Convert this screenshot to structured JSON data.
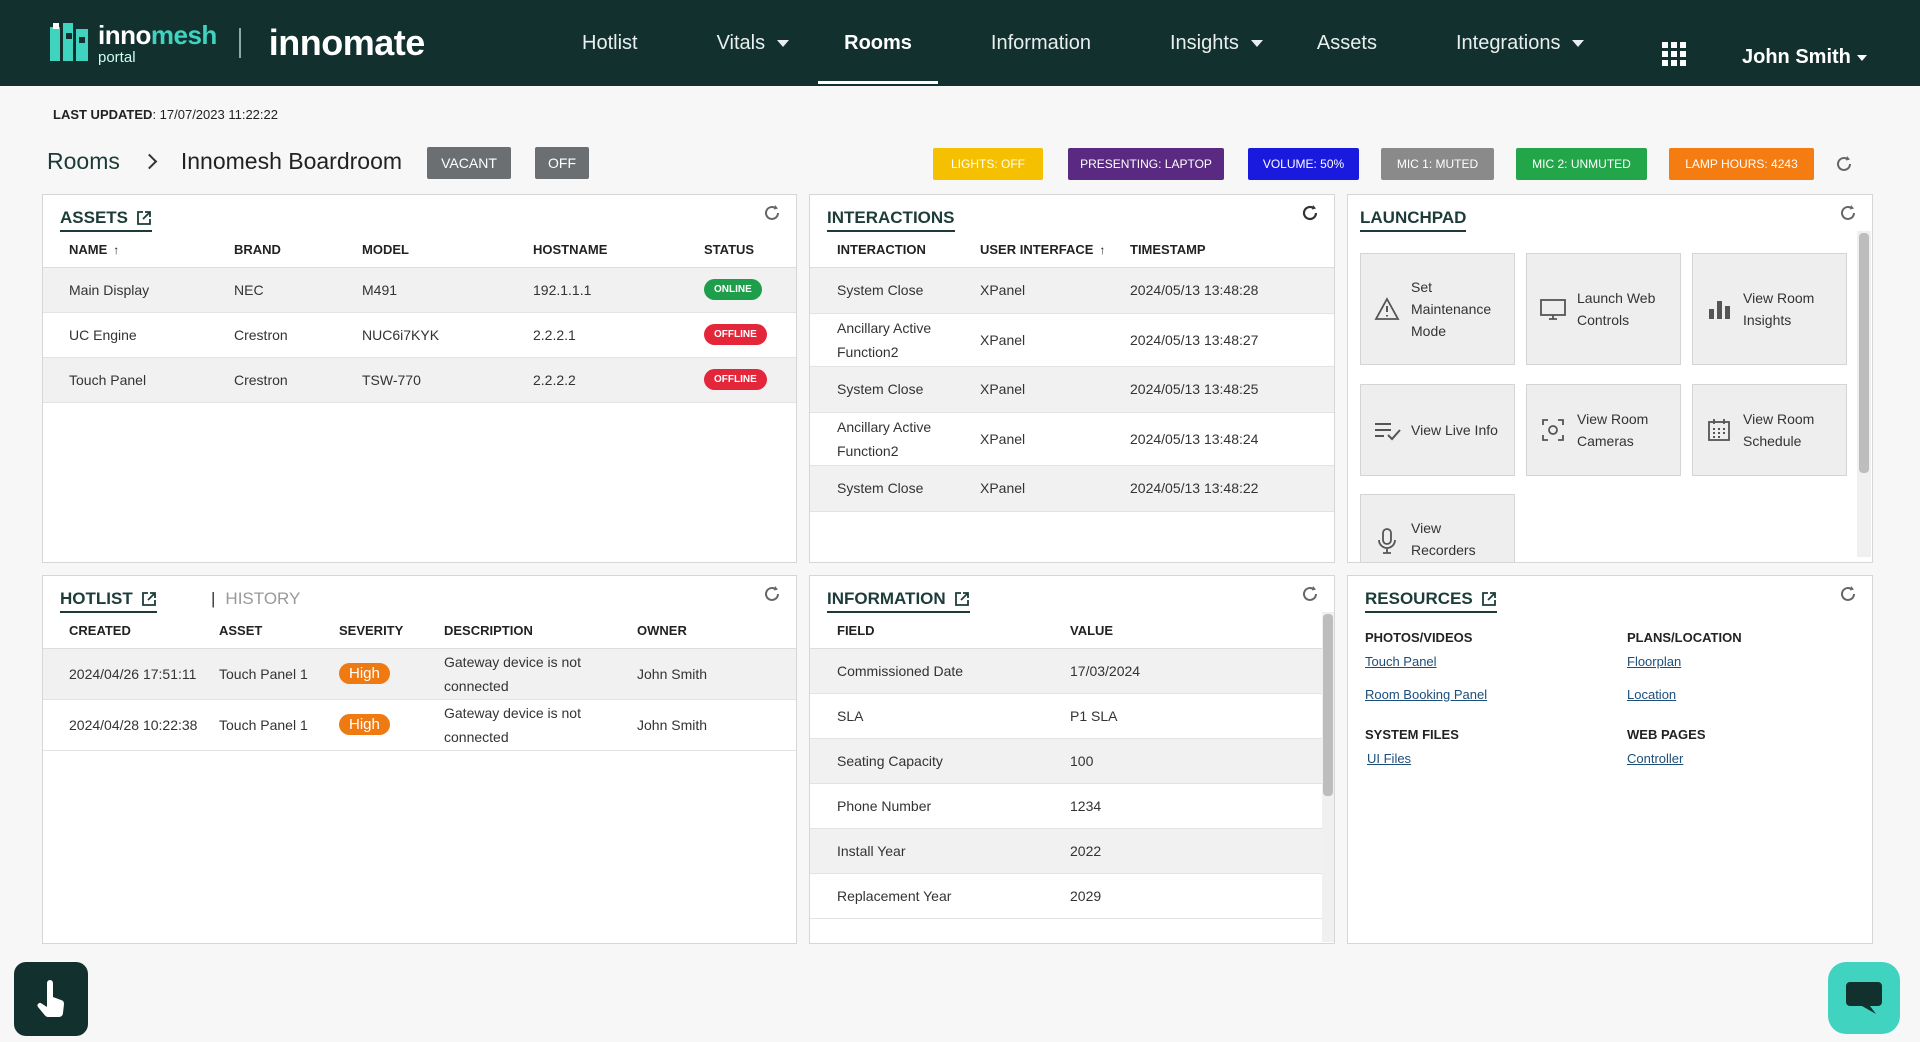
{
  "brand": {
    "innomesh_a": "inno",
    "innomesh_b": "mesh",
    "portal": "portal",
    "innomate": "innomate"
  },
  "nav": [
    {
      "label": "Hotlist",
      "dropdown": false,
      "active": false
    },
    {
      "label": "Vitals",
      "dropdown": true,
      "active": false
    },
    {
      "label": "Rooms",
      "dropdown": false,
      "active": true
    },
    {
      "label": "Information",
      "dropdown": false,
      "active": false
    },
    {
      "label": "Insights",
      "dropdown": true,
      "active": false
    },
    {
      "label": "Assets",
      "dropdown": false,
      "active": false
    },
    {
      "label": "Integrations",
      "dropdown": true,
      "active": false
    }
  ],
  "user": {
    "name": "John Smith"
  },
  "last_updated": {
    "label": "LAST UPDATED",
    "value": ": 17/07/2023 11:22:22"
  },
  "breadcrumb": {
    "root": "Rooms",
    "current": "Innomesh Boardroom"
  },
  "room_state": {
    "occupancy": "VACANT",
    "power": "OFF"
  },
  "status_badges": [
    {
      "label": "LIGHTS: OFF",
      "color": "#f5c000",
      "text_color": "#ffffff"
    },
    {
      "label": "PRESENTING: LAPTOP",
      "color": "#5a2a82",
      "text_color": "#ffffff"
    },
    {
      "label": "VOLUME: 50%",
      "color": "#1a1adf",
      "text_color": "#ffffff"
    },
    {
      "label": "MIC 1: MUTED",
      "color": "#8a8a8a",
      "text_color": "#ffffff"
    },
    {
      "label": "MIC 2: UNMUTED",
      "color": "#23a54a",
      "text_color": "#ffffff"
    },
    {
      "label": "LAMP HOURS: 4243",
      "color": "#f57c10",
      "text_color": "#ffffff"
    }
  ],
  "assets": {
    "title": "ASSETS",
    "columns": [
      "NAME",
      "BRAND",
      "MODEL",
      "HOSTNAME",
      "STATUS"
    ],
    "rows": [
      {
        "name": "Main Display",
        "brand": "NEC",
        "model": "M491",
        "hostname": "192.1.1.1",
        "status": "ONLINE"
      },
      {
        "name": "UC Engine",
        "brand": "Crestron",
        "model": "NUC6i7KYK",
        "hostname": "2.2.2.1",
        "status": "OFFLINE"
      },
      {
        "name": "Touch Panel",
        "brand": "Crestron",
        "model": "TSW-770",
        "hostname": "2.2.2.2",
        "status": "OFFLINE"
      }
    ]
  },
  "interactions": {
    "title": "INTERACTIONS",
    "columns": [
      "INTERACTION",
      "USER INTERFACE",
      "TIMESTAMP"
    ],
    "rows": [
      {
        "interaction": "System Close",
        "ui": "XPanel",
        "timestamp": "2024/05/13 13:48:28"
      },
      {
        "interaction": "Ancillary Active Function2",
        "ui": "XPanel",
        "timestamp": "2024/05/13 13:48:27"
      },
      {
        "interaction": "System Close",
        "ui": "XPanel",
        "timestamp": "2024/05/13 13:48:25"
      },
      {
        "interaction": "Ancillary Active Function2",
        "ui": "XPanel",
        "timestamp": "2024/05/13 13:48:24"
      },
      {
        "interaction": "System Close",
        "ui": "XPanel",
        "timestamp": "2024/05/13 13:48:22"
      }
    ]
  },
  "launchpad": {
    "title": "LAUNCHPAD",
    "tiles": [
      {
        "label": "Set Maintenance Mode",
        "icon": "warning-icon"
      },
      {
        "label": "Launch Web Controls",
        "icon": "monitor-icon"
      },
      {
        "label": "View Room Insights",
        "icon": "bar-chart-icon"
      },
      {
        "label": "View Live Info",
        "icon": "list-check-icon"
      },
      {
        "label": "View Room Cameras",
        "icon": "camera-icon"
      },
      {
        "label": "View Room Schedule",
        "icon": "calendar-icon"
      },
      {
        "label": "View Recorders",
        "icon": "microphone-icon"
      }
    ]
  },
  "hotlist": {
    "title": "HOTLIST",
    "history_label": "HISTORY",
    "columns": [
      "CREATED",
      "ASSET",
      "SEVERITY",
      "DESCRIPTION",
      "OWNER"
    ],
    "rows": [
      {
        "created": "2024/04/26 17:51:11",
        "asset": "Touch Panel 1",
        "severity": "High",
        "description": "Gateway device is not connected",
        "owner": "John Smith"
      },
      {
        "created": "2024/04/28 10:22:38",
        "asset": "Touch Panel 1",
        "severity": "High",
        "description": "Gateway device is not connected",
        "owner": "John Smith"
      }
    ]
  },
  "information": {
    "title": "INFORMATION",
    "columns": [
      "FIELD",
      "VALUE"
    ],
    "rows": [
      {
        "field": "Commissioned Date",
        "value": "17/03/2024"
      },
      {
        "field": "SLA",
        "value": "P1 SLA"
      },
      {
        "field": "Seating Capacity",
        "value": "100"
      },
      {
        "field": "Phone Number",
        "value": "1234"
      },
      {
        "field": "Install Year",
        "value": "2022"
      },
      {
        "field": "Replacement Year",
        "value": "2029"
      }
    ]
  },
  "resources": {
    "title": "RESOURCES",
    "groups": [
      {
        "heading": "PHOTOS/VIDEOS",
        "links": [
          "Touch Panel",
          "Room Booking Panel"
        ]
      },
      {
        "heading": "PLANS/LOCATION",
        "links": [
          "Floorplan",
          "Location"
        ]
      },
      {
        "heading": "SYSTEM FILES",
        "links": [
          "UI Files"
        ]
      },
      {
        "heading": "WEB PAGES",
        "links": [
          "Controller"
        ]
      }
    ]
  },
  "colors": {
    "nav_bg": "#12302d",
    "accent": "#3fd3c0"
  }
}
